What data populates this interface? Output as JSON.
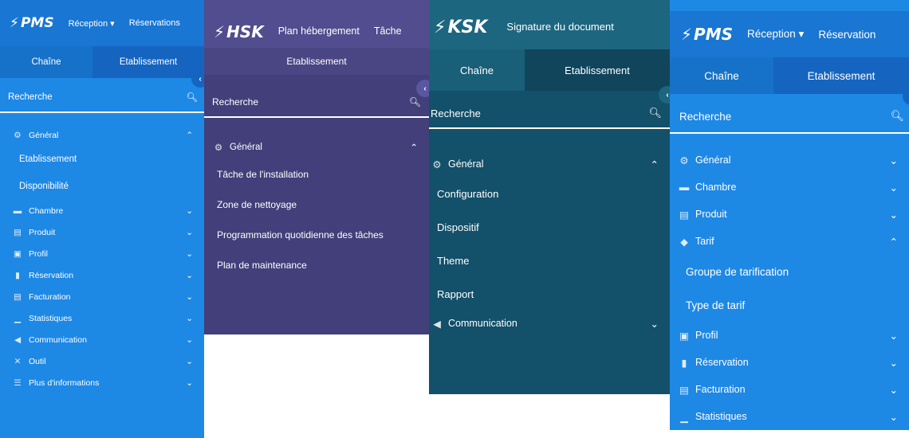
{
  "panel1": {
    "logo": "PMS",
    "nav": [
      "Réception ▾",
      "Réservations"
    ],
    "tabs": [
      "Chaîne",
      "Etablissement"
    ],
    "search_label": "Recherche",
    "general": "Général",
    "general_items": [
      "Etablissement",
      "Disponibilité"
    ],
    "sections": [
      {
        "icon": "bed-icon",
        "label": "Chambre"
      },
      {
        "icon": "product-icon",
        "label": "Produit"
      },
      {
        "icon": "profile-icon",
        "label": "Profil"
      },
      {
        "icon": "reservation-icon",
        "label": "Réservation"
      },
      {
        "icon": "invoice-icon",
        "label": "Facturation"
      },
      {
        "icon": "stats-icon",
        "label": "Statistiques"
      },
      {
        "icon": "megaphone-icon",
        "label": "Communication"
      },
      {
        "icon": "tools-icon",
        "label": "Outil"
      },
      {
        "icon": "sliders-icon",
        "label": "Plus d'informations"
      }
    ]
  },
  "panel2": {
    "logo": "HSK",
    "nav": [
      "Plan hébergement",
      "Tâche"
    ],
    "header": "Etablissement",
    "search_label": "Recherche",
    "general": "Général",
    "items": [
      "Tâche de l'installation",
      "Zone de nettoyage",
      "Programmation quotidienne des tâches",
      "Plan de maintenance"
    ]
  },
  "panel3": {
    "logo": "KSK",
    "nav": [
      "Signature du document"
    ],
    "tabs": [
      "Chaîne",
      "Etablissement"
    ],
    "search_label": "Recherche",
    "general": "Général",
    "items": [
      "Configuration",
      "Dispositif",
      "Theme",
      "Rapport"
    ],
    "communication": "Communication"
  },
  "panel4": {
    "logo": "PMS",
    "nav": [
      "Réception ▾",
      "Réservation"
    ],
    "tabs": [
      "Chaîne",
      "Etablissement"
    ],
    "search_label": "Recherche",
    "sections_top": [
      {
        "icon": "gears-icon",
        "label": "Général"
      },
      {
        "icon": "bed-icon",
        "label": "Chambre"
      },
      {
        "icon": "product-icon",
        "label": "Produit"
      },
      {
        "icon": "tag-icon",
        "label": "Tarif"
      }
    ],
    "tarif_items": [
      "Groupe de tarification",
      "Type de tarif"
    ],
    "sections_bottom": [
      {
        "icon": "profile-icon",
        "label": "Profil"
      },
      {
        "icon": "reservation-icon",
        "label": "Réservation"
      },
      {
        "icon": "invoice-icon",
        "label": "Facturation"
      },
      {
        "icon": "stats-icon",
        "label": "Statistiques"
      }
    ]
  }
}
